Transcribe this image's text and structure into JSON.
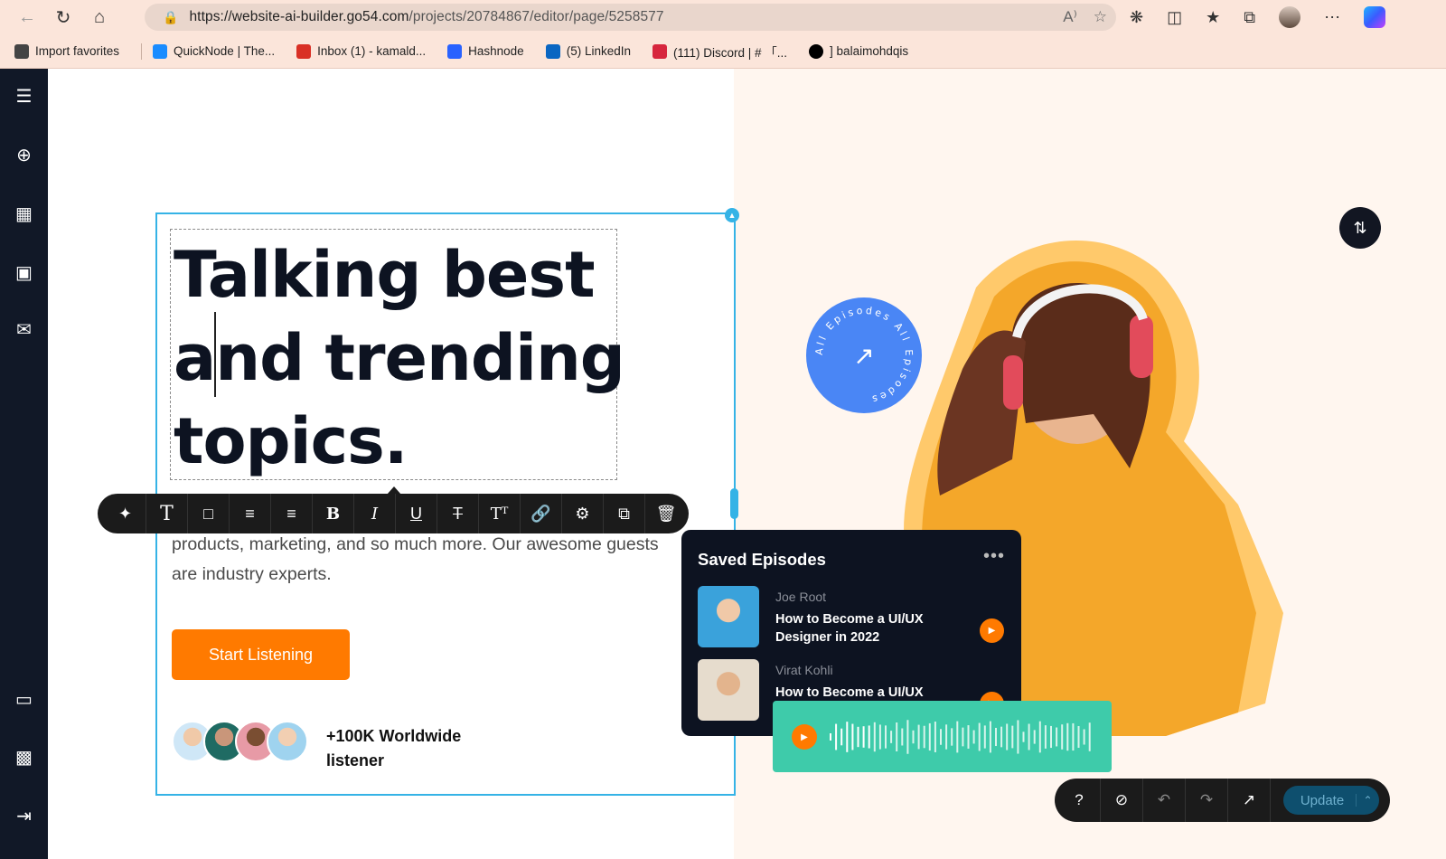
{
  "browser": {
    "url_main": "https://website-ai-builder.go54.com",
    "url_path": "/projects/20784867/editor/page/5258577",
    "favorites": [
      {
        "label": "Import favorites",
        "icon": "import-icon",
        "color": "#444444"
      },
      {
        "label": "QuickNode | The...",
        "icon": "quicknode-icon",
        "color": "#1a8cff"
      },
      {
        "label": "Inbox (1) - kamald...",
        "icon": "gmail-icon",
        "color": "#d93025"
      },
      {
        "label": "Hashnode",
        "icon": "hashnode-icon",
        "color": "#2962ff"
      },
      {
        "label": "(5) LinkedIn",
        "icon": "linkedin-icon",
        "color": "#0a66c2"
      },
      {
        "label": "(111) Discord | # 「...",
        "icon": "discord-icon",
        "color": "#d7263d"
      },
      {
        "label": "] balaimohdqis",
        "icon": "circle-icon",
        "color": "#000000"
      }
    ]
  },
  "editor": {
    "headline": "Talking best and trending topics.",
    "body": "Today's famous and exciting conversations about UI/UX design, products, marketing, and so much more. Our awesome guests are industry experts.",
    "cta_label": "Start Listening",
    "listeners": "+100K Worldwide listener",
    "badge_text": "All Episodes All Episodes",
    "toolbar_actions": [
      "ai-magic-icon",
      "text-type-icon",
      "border-icon",
      "align-left-icon",
      "align-center-icon",
      "bold-icon",
      "italic-icon",
      "underline-icon",
      "strikethrough-icon",
      "text-size-icon",
      "link-icon",
      "settings-icon",
      "duplicate-icon",
      "delete-icon"
    ],
    "bottom_actions": [
      "help-icon",
      "hide-icon",
      "undo-icon",
      "redo-icon",
      "external-link-icon"
    ],
    "update_label": "Update"
  },
  "saved_episodes": {
    "title": "Saved Episodes",
    "items": [
      {
        "author": "Joe Root",
        "title": "How to Become a UI/UX Designer in 2022"
      },
      {
        "author": "Virat Kohli",
        "title": "How to Become a UI/UX"
      }
    ]
  },
  "colors": {
    "accent": "#ff7a00",
    "selection": "#35b3e6",
    "badge": "#4a86f5",
    "player": "#3ecbaa",
    "dark": "#0d1321"
  }
}
